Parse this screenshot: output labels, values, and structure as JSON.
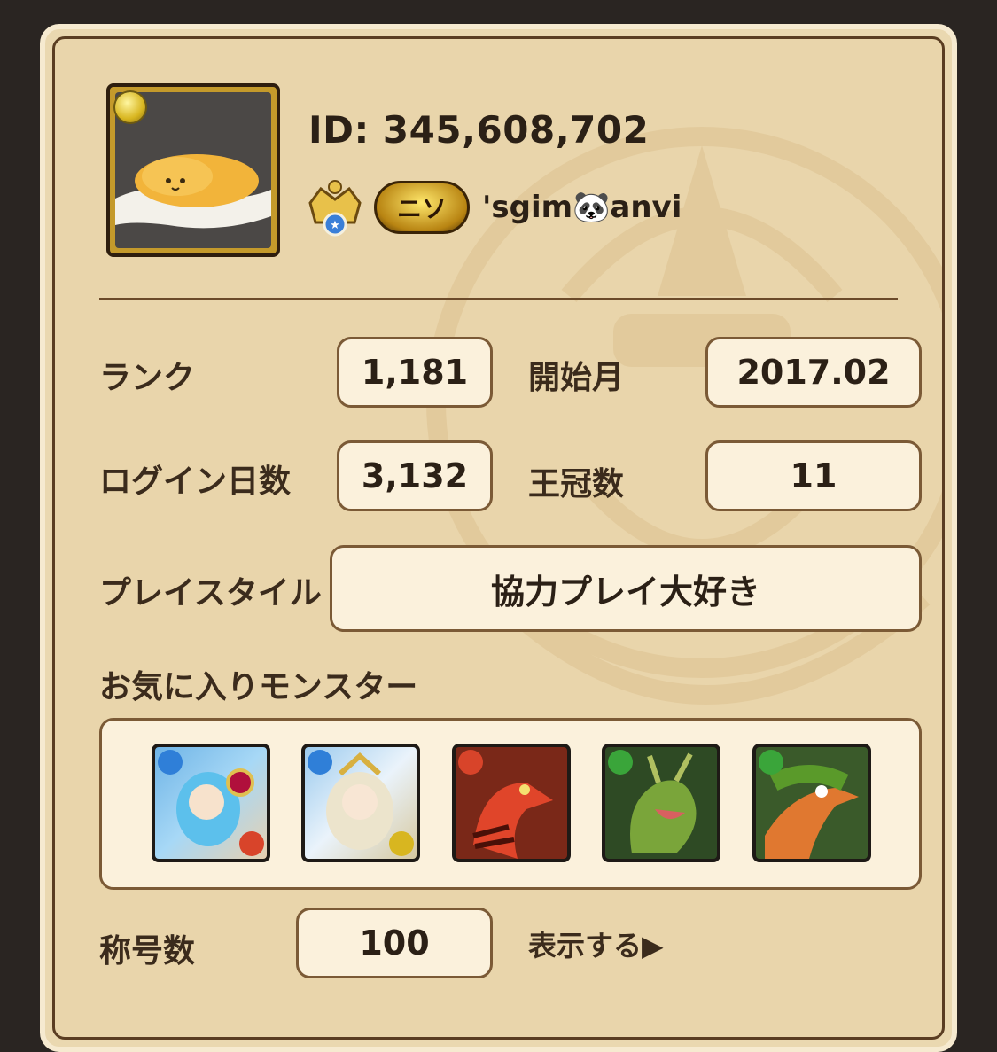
{
  "profile": {
    "id_text": "ID: 345,608,702",
    "player_name": "'sgim🐼anvi",
    "title_badge_text": "ニソ",
    "avatar_icon": "gudetama-avatar-icon",
    "avatar_attribute_icon": "light-attribute-orb-icon"
  },
  "stats": {
    "rank_label": "ランク",
    "rank_value": "1,181",
    "start_label": "開始月",
    "start_value": "2017.02",
    "login_label": "ログイン日数",
    "login_value": "3,132",
    "crown_label": "王冠数",
    "crown_value": "11",
    "style_label": "プレイスタイル",
    "style_value": "協力プレイ大好き"
  },
  "favorites": {
    "heading": "お気に入りモンスター",
    "monsters": [
      {
        "icon": "water-fire-girl-monster-icon",
        "main_attr": "#2f7fd8",
        "sub_attr": "#d8442a"
      },
      {
        "icon": "water-light-girl-monster-icon",
        "main_attr": "#2f7fd8",
        "sub_attr": "#d8b620"
      },
      {
        "icon": "fire-dragon-monster-icon",
        "main_attr": "#d8442a"
      },
      {
        "icon": "wood-dragon-monster-icon",
        "main_attr": "#3aa53a"
      },
      {
        "icon": "wood-bird-dragon-monster-icon",
        "main_attr": "#3aa53a"
      }
    ]
  },
  "titles": {
    "label": "称号数",
    "value": "100",
    "show_link": "表示する▶"
  },
  "colors": {
    "card_bg": "#e9d5ab",
    "border_brown": "#7b5a36",
    "text_dark": "#2b2016"
  }
}
